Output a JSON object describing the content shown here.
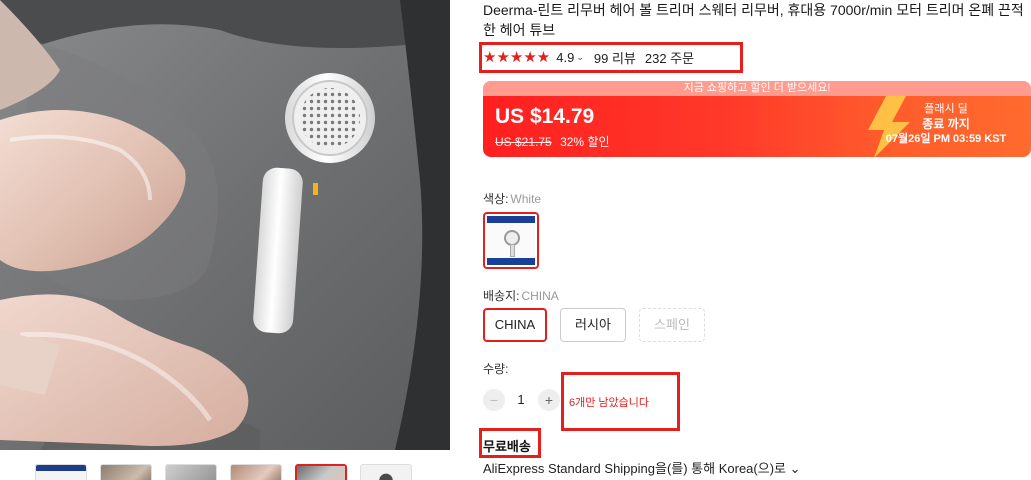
{
  "product": {
    "title": "Deerma-린트 리무버 헤어 볼 트리머 스웨터 리무버, 휴대용 7000r/min 모터 트리머 온폐 끈적한 헤어 튜브"
  },
  "rating": {
    "stars": "★★★★★",
    "score": "4.9",
    "reviews": "99 리뷰",
    "orders": "232 주문"
  },
  "promo": {
    "banner": "지금 쇼핑하고 할인 더 받으세요!",
    "price": "US $14.79",
    "original_price": "US $21.75",
    "discount": "32% 할인",
    "flash_title": "플래시 딜",
    "flash_ends": "종료 까지",
    "flash_time": "07월26일 PM 03:59 KST"
  },
  "color": {
    "label": "색상:",
    "value": "White"
  },
  "ship_from": {
    "label": "배송지:",
    "value": "CHINA",
    "options": [
      "CHINA",
      "러시아",
      "스페인"
    ]
  },
  "quantity": {
    "label": "수량:",
    "minus": "−",
    "value": "1",
    "plus": "+",
    "stock_note": "6개만 남았습니다"
  },
  "shipping": {
    "free": "무료배송",
    "method": "AliExpress Standard Shipping을(를) 통해 Korea(으)로 ⌄"
  },
  "colors": {
    "accent": "#e4201d",
    "promo_from": "#ff1f1f",
    "promo_to": "#ff6a2e"
  }
}
